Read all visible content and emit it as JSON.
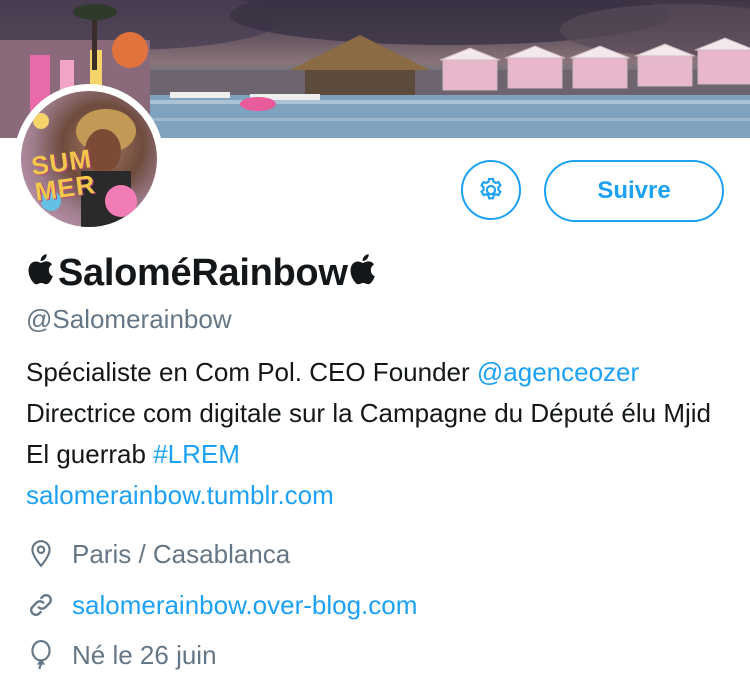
{
  "profile": {
    "display_name": "SaloméRainbow",
    "name_emoji_left": "",
    "name_emoji_right": "",
    "handle": "@Salomerainbow",
    "avatar_text_line1": "SUM",
    "avatar_text_line2": "MER"
  },
  "buttons": {
    "follow_label": "Suivre"
  },
  "bio": {
    "part1": "Spécialiste en Com Pol. CEO Founder ",
    "mention": "@agenceozer",
    "part2": " Directrice com digitale sur la Campagne du Député élu Mjid El guerrab ",
    "hashtag": "#LREM",
    "url": "salomerainbow.tumblr.com"
  },
  "meta": {
    "location": "Paris / Casablanca",
    "website": "salomerainbow.over-blog.com",
    "birthday": "Né le 26 juin"
  },
  "colors": {
    "accent": "#1da1f2",
    "secondary_text": "#657786",
    "primary_text": "#14171a"
  },
  "icons": {
    "settings": "gear-icon",
    "location": "location-pin-icon",
    "website": "link-icon",
    "birthday": "balloon-icon"
  }
}
